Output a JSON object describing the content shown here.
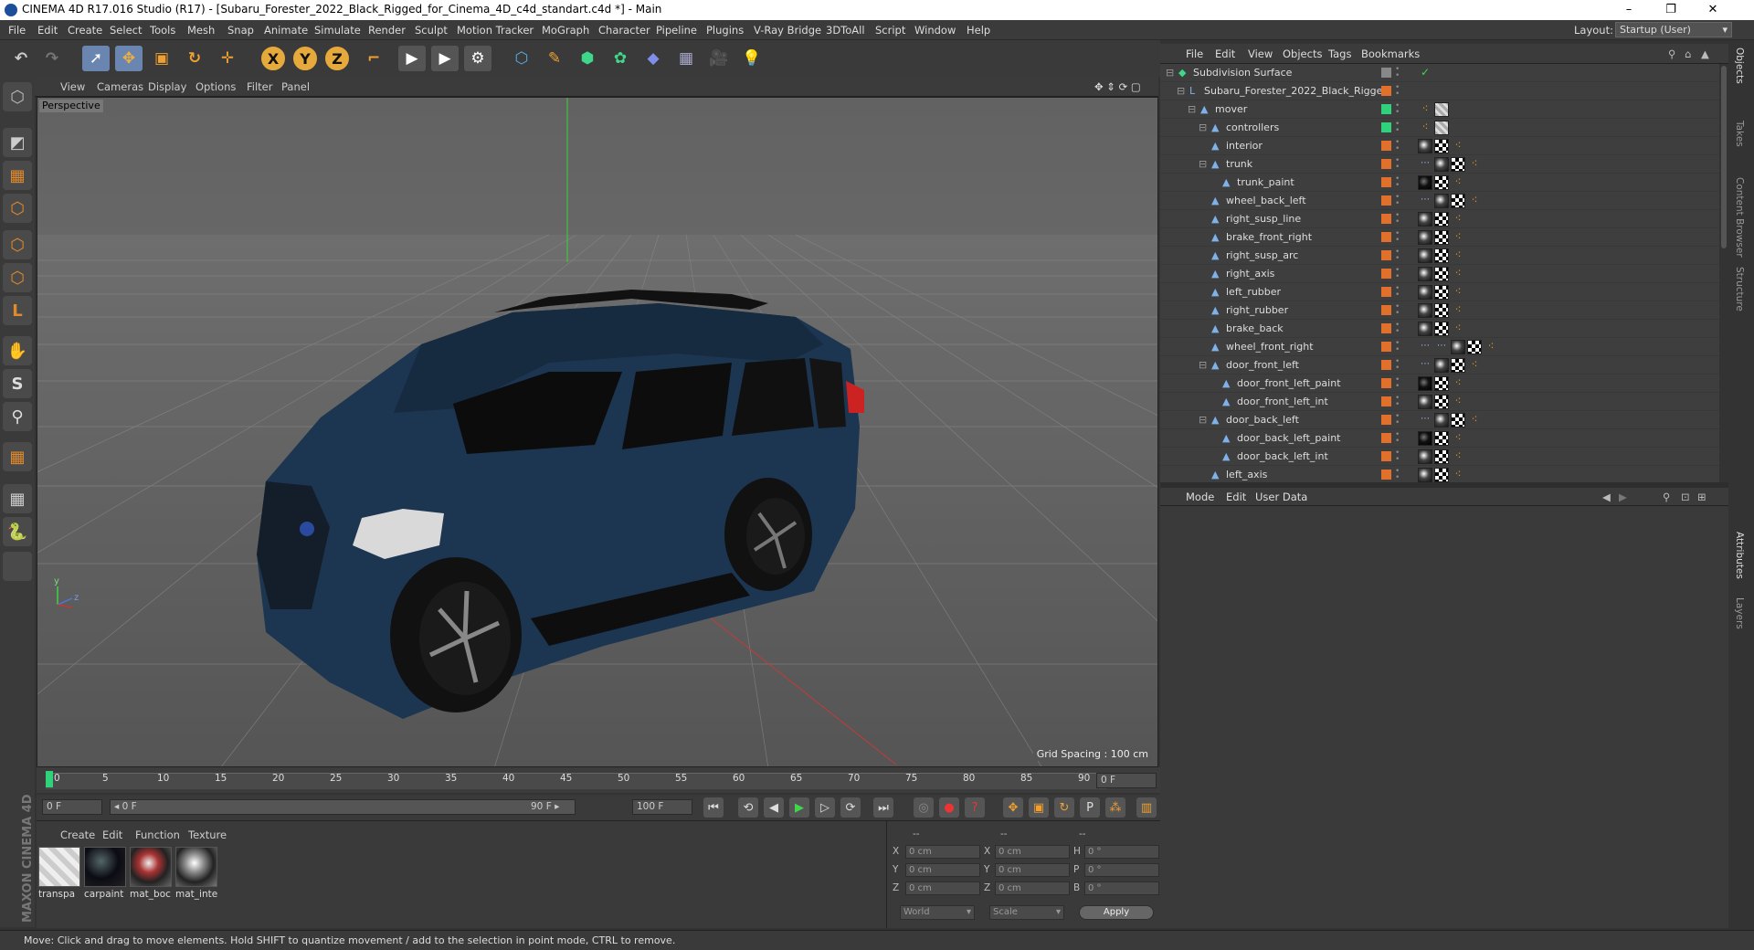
{
  "window": {
    "title": "CINEMA 4D R17.016 Studio (R17) - [Subaru_Forester_2022_Black_Rigged_for_Cinema_4D_c4d_standart.c4d *] - Main",
    "minimize": "–",
    "maximize": "❐",
    "close": "✕"
  },
  "menubar": {
    "items": [
      "File",
      "Edit",
      "Create",
      "Select",
      "Tools",
      "Mesh",
      "Snap",
      "Animate",
      "Simulate",
      "Render",
      "Sculpt",
      "Motion Tracker",
      "MoGraph",
      "Character",
      "Pipeline",
      "Plugins",
      "V-Ray Bridge",
      "3DToAll",
      "Script",
      "Window",
      "Help"
    ],
    "layout_label": "Layout:",
    "layout_value": "Startup (User)"
  },
  "toolbar": {
    "undo": "↶",
    "redo": "↷",
    "live_select": "➚",
    "move": "✥",
    "scale": "▣",
    "rotate": "↻",
    "transform": "✛",
    "x": "X",
    "y": "Y",
    "z": "Z",
    "coord_system": "⌐",
    "render_view": "▶",
    "render": "▶",
    "render_settings": "⚙",
    "cube": "⬡",
    "pen": "✎",
    "subdivision": "⬢",
    "mograph": "✿",
    "deformer": "◆",
    "floor": "▦",
    "camera": "🎥",
    "light": "💡"
  },
  "left_tools": [
    "⬡",
    "◩",
    "▦",
    "⬡",
    "⬡",
    "⬡",
    "L",
    "✋",
    "S",
    "⚲",
    "▦",
    "▦",
    "🐍"
  ],
  "viewport": {
    "menu": [
      "View",
      "Cameras",
      "Display",
      "Options",
      "Filter",
      "Panel"
    ],
    "label": "Perspective",
    "grid_spacing": "Grid Spacing : 100 cm",
    "axis_y": "y",
    "axis_z": "z"
  },
  "timeline": {
    "ticks": [
      "0",
      "5",
      "10",
      "15",
      "20",
      "25",
      "30",
      "35",
      "40",
      "45",
      "50",
      "55",
      "60",
      "65",
      "70",
      "75",
      "80",
      "85",
      "90"
    ],
    "current_frame": "0 F"
  },
  "transport": {
    "start": "0 F",
    "range_start": "◂ 0 F",
    "range_end": "90 F ▸",
    "end": "100 F",
    "buttons": [
      "⏮",
      "⟲",
      "◀",
      "▶",
      "▷",
      "⟳",
      "⏭"
    ]
  },
  "materials": {
    "menu": [
      "Create",
      "Edit",
      "Function",
      "Texture"
    ],
    "items": [
      {
        "label": "transpa",
        "kind": "transparent"
      },
      {
        "label": "carpaint",
        "kind": "dark"
      },
      {
        "label": "mat_boc",
        "kind": "chrome"
      },
      {
        "label": "mat_inte",
        "kind": "chrome2"
      }
    ]
  },
  "coords": {
    "header": [
      "--",
      "--",
      "--"
    ],
    "rows": [
      {
        "a": "X",
        "av": "0 cm",
        "b": "X",
        "bv": "0 cm",
        "c": "H",
        "cv": "0 °"
      },
      {
        "a": "Y",
        "av": "0 cm",
        "b": "Y",
        "bv": "0 cm",
        "c": "P",
        "cv": "0 °"
      },
      {
        "a": "Z",
        "av": "0 cm",
        "b": "Z",
        "bv": "0 cm",
        "c": "B",
        "cv": "0 °"
      }
    ],
    "world": "World",
    "scale": "Scale",
    "apply": "Apply"
  },
  "status": {
    "message": "Move: Click and drag to move elements. Hold SHIFT to quantize movement / add to the selection in point mode, CTRL to remove."
  },
  "maxon": "MAXON CINEMA 4D",
  "object_manager": {
    "menu": [
      "File",
      "Edit",
      "View",
      "Objects",
      "Tags",
      "Bookmarks"
    ],
    "objects": [
      {
        "name": "Subdivision Surface",
        "depth": 0,
        "color": "#888888",
        "tags": [
          "check"
        ]
      },
      {
        "name": "Subaru_Forester_2022_Black_Rigged",
        "depth": 1,
        "color": "#e0702a",
        "tags": []
      },
      {
        "name": "mover",
        "depth": 2,
        "color": "#2fd17a",
        "tags": [
          "dots",
          "grey"
        ]
      },
      {
        "name": "controllers",
        "depth": 3,
        "color": "#2fd17a",
        "tags": [
          "dots",
          "grey"
        ]
      },
      {
        "name": "interior",
        "depth": 3,
        "color": "#e0702a",
        "tags": [
          "sphere",
          "checker",
          "dots"
        ]
      },
      {
        "name": "trunk",
        "depth": 3,
        "color": "#e0702a",
        "tags": [
          "pts",
          "sphere",
          "checker",
          "dots"
        ]
      },
      {
        "name": "trunk_paint",
        "depth": 4,
        "color": "#e0702a",
        "tags": [
          "black",
          "checker",
          "dots"
        ]
      },
      {
        "name": "wheel_back_left",
        "depth": 3,
        "color": "#e0702a",
        "tags": [
          "pts",
          "sphere",
          "checker",
          "dots"
        ]
      },
      {
        "name": "right_susp_line",
        "depth": 3,
        "color": "#e0702a",
        "tags": [
          "sphere",
          "checker",
          "dots"
        ]
      },
      {
        "name": "brake_front_right",
        "depth": 3,
        "color": "#e0702a",
        "tags": [
          "sphere",
          "checker",
          "dots"
        ]
      },
      {
        "name": "right_susp_arc",
        "depth": 3,
        "color": "#e0702a",
        "tags": [
          "sphere",
          "checker",
          "dots"
        ]
      },
      {
        "name": "right_axis",
        "depth": 3,
        "color": "#e0702a",
        "tags": [
          "sphere",
          "checker",
          "dots"
        ]
      },
      {
        "name": "left_rubber",
        "depth": 3,
        "color": "#e0702a",
        "tags": [
          "sphere",
          "checker",
          "dots"
        ]
      },
      {
        "name": "right_rubber",
        "depth": 3,
        "color": "#e0702a",
        "tags": [
          "sphere",
          "checker",
          "dots"
        ]
      },
      {
        "name": "brake_back",
        "depth": 3,
        "color": "#e0702a",
        "tags": [
          "sphere",
          "checker",
          "dots"
        ]
      },
      {
        "name": "wheel_front_right",
        "depth": 3,
        "color": "#e0702a",
        "tags": [
          "pts",
          "pts",
          "sphere",
          "checker",
          "dots"
        ]
      },
      {
        "name": "door_front_left",
        "depth": 3,
        "color": "#e0702a",
        "tags": [
          "pts",
          "sphere",
          "checker",
          "dots"
        ]
      },
      {
        "name": "door_front_left_paint",
        "depth": 4,
        "color": "#e0702a",
        "tags": [
          "black",
          "checker",
          "dots"
        ]
      },
      {
        "name": "door_front_left_int",
        "depth": 4,
        "color": "#e0702a",
        "tags": [
          "sphere",
          "checker",
          "dots"
        ]
      },
      {
        "name": "door_back_left",
        "depth": 3,
        "color": "#e0702a",
        "tags": [
          "pts",
          "sphere",
          "checker",
          "dots"
        ]
      },
      {
        "name": "door_back_left_paint",
        "depth": 4,
        "color": "#e0702a",
        "tags": [
          "black",
          "checker",
          "dots"
        ]
      },
      {
        "name": "door_back_left_int",
        "depth": 4,
        "color": "#e0702a",
        "tags": [
          "sphere",
          "checker",
          "dots"
        ]
      },
      {
        "name": "left_axis",
        "depth": 3,
        "color": "#e0702a",
        "tags": [
          "sphere",
          "checker",
          "dots"
        ]
      }
    ]
  },
  "attributes": {
    "menu": [
      "Mode",
      "Edit",
      "User Data"
    ]
  },
  "right_tabs": [
    "Objects",
    "Takes",
    "Content Browser",
    "Structure",
    "Attributes",
    "Layers"
  ]
}
